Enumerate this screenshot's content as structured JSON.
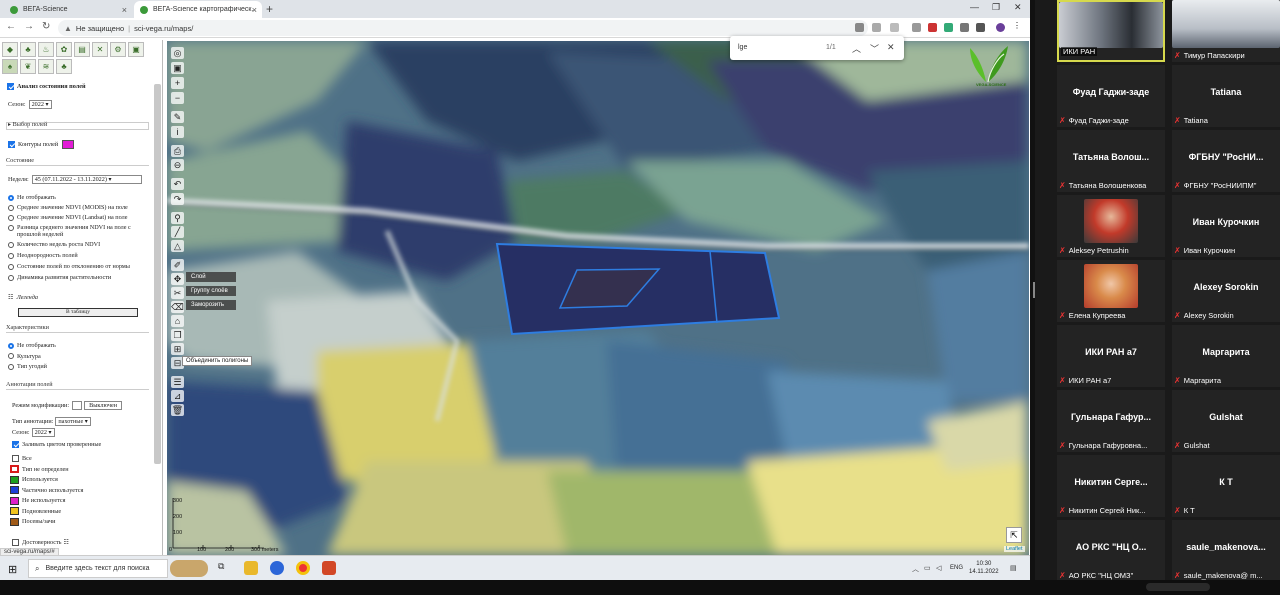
{
  "browser": {
    "tabs": [
      {
        "title": "ВЕГА-Science",
        "active": false
      },
      {
        "title": "ВЕГА-Science картографическ...",
        "active": true
      }
    ],
    "address": {
      "security": "Не защищено",
      "url": "sci-vega.ru/maps/"
    },
    "status_url": "sci-vega.ru/maps/#"
  },
  "find_bar": {
    "query": "lge",
    "count": "1/1"
  },
  "left_panel": {
    "analysis_title": "Анализ состояния полей",
    "season_label": "Сезон:",
    "season_value": "2022",
    "field_select_label": "Выбор полей",
    "field_contours_label": "Контуры полей",
    "field_contours_color": "#e21bd6",
    "state_section": "Состояние",
    "week_label": "Неделя:",
    "week_value": "45 (07.11.2022 - 13.11.2022)",
    "state_options": [
      "Не отображать",
      "Среднее значение NDVI (MODIS) на поле",
      "Среднее значение NDVI (Landsat) на поле",
      "Разница среднего значения NDVI на поле с",
      "прошлой неделей",
      "Количество недель роста NDVI",
      "Неоднородность полей",
      "Состояние полей по отклонению от нормы",
      "Динамика развития растительности"
    ],
    "legend_label": "Легенда",
    "table_button": "В таблицу",
    "characteristics_section": "Характеристики",
    "characteristics_options": [
      "Не отображать",
      "Культура",
      "Тип угодий"
    ],
    "annotation_section": "Аннотации полей",
    "modification_label": "Режим модификации:",
    "modification_button": "Выключен",
    "annotation_type_label": "Тип аннотации:",
    "annotation_type_value": "пахотные",
    "annotation_season_label": "Сезон:",
    "annotation_season_value": "2022",
    "fill_checked_label": "Заливать цветом проверенные",
    "all_label": "Все",
    "legend_items": [
      {
        "label": "Тип не определен",
        "color": "#d81b1b",
        "style": "outline"
      },
      {
        "label": "Используется",
        "color": "#1f9e1f",
        "style": "solid"
      },
      {
        "label": "Частично используется",
        "color": "#1c3fd6",
        "style": "solid"
      },
      {
        "label": "Не используется",
        "color": "#e020c8",
        "style": "solid"
      },
      {
        "label": "Подновленные",
        "color": "#f0c31c",
        "style": "solid"
      },
      {
        "label": "Посевы/зачи",
        "color": "#a05a18",
        "style": "solid"
      }
    ],
    "reliability_label": "Достоверность"
  },
  "map": {
    "context_menu": [
      "Слой",
      "Группу слоёв",
      "Заморозить"
    ],
    "tooltip": "Объединить полигоны",
    "logo_text": "VEGA-SCIENCE",
    "scale_ticks": [
      "0",
      "100",
      "200",
      "300 meters"
    ],
    "scale_vertical": [
      "300",
      "200",
      "100"
    ],
    "attribution": "Leaflet"
  },
  "taskbar": {
    "search_placeholder": "Введите здесь текст для поиска",
    "lang": "ENG",
    "time": "10:30",
    "date": "14.11.2022"
  },
  "video_call": {
    "participants": [
      {
        "display": "",
        "label": "ИКИ РАН",
        "video": true,
        "active": true
      },
      {
        "display": "",
        "label": "Тимур Папаскири",
        "video": true
      },
      {
        "display": "Фуад Гаджи-заде",
        "label": "Фуад Гаджи-заде"
      },
      {
        "display": "Tatiana",
        "label": "Tatiana"
      },
      {
        "display": "Татьяна Волош...",
        "label": "Татьяна Волошенкова"
      },
      {
        "display": "ФГБНУ \"РосНИ...",
        "label": "ФГБНУ \"РосНИИПМ\""
      },
      {
        "display": "",
        "label": "Aleksey Petrushin",
        "video": true
      },
      {
        "display": "Иван Курочкин",
        "label": "Иван Курочкин"
      },
      {
        "display": "",
        "label": "Елена Купреева",
        "video": true
      },
      {
        "display": "Alexey Sorokin",
        "label": "Alexey Sorokin"
      },
      {
        "display": "ИКИ РАН а7",
        "label": "ИКИ РАН а7"
      },
      {
        "display": "Маргарита",
        "label": "Маргарита"
      },
      {
        "display": "Гульнара Гафур...",
        "label": "Гульнара Гафуровна..."
      },
      {
        "display": "Gulshat",
        "label": "Gulshat"
      },
      {
        "display": "Никитин Серге...",
        "label": "Никитин Сергей Ник..."
      },
      {
        "display": "К Т",
        "label": "К Т"
      },
      {
        "display": "АО РКС \"НЦ О...",
        "label": "АО РКС \"НЦ ОМЗ\""
      },
      {
        "display": "saule_makenova...",
        "label": "saule_makenova@ m..."
      }
    ]
  }
}
